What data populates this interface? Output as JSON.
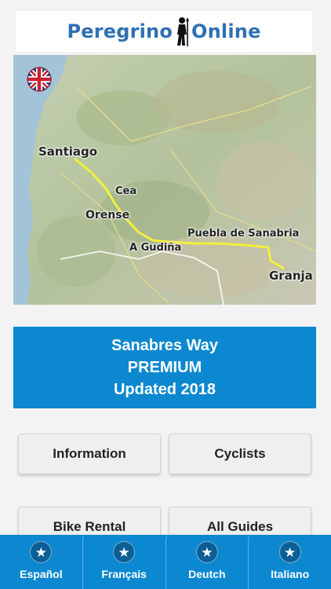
{
  "logo": {
    "text_left": "Peregrino",
    "text_right": "Online"
  },
  "map": {
    "flag_icon": "uk-flag-icon",
    "labels": {
      "santiago": "Santiago",
      "cea": "Cea",
      "orense": "Orense",
      "gudina": "A Gudiña",
      "puebla": "Puebla de Sanabria",
      "granja": "Granja"
    }
  },
  "premium": {
    "line1": "Sanabres Way",
    "line2": "PREMIUM",
    "line3": "Updated 2018"
  },
  "buttons": {
    "information": "Information",
    "cyclists": "Cyclists",
    "bike_rental": "Bike Rental",
    "all_guides": "All Guides"
  },
  "tabs": [
    {
      "label": "Español",
      "icon": "star-icon"
    },
    {
      "label": "Français",
      "icon": "star-icon"
    },
    {
      "label": "Deutch",
      "icon": "star-icon"
    },
    {
      "label": "Italiano",
      "icon": "star-icon"
    }
  ],
  "colors": {
    "brand_blue": "#0b88d0",
    "logo_blue": "#2f6fb3",
    "route_yellow": "#f2f03c"
  }
}
